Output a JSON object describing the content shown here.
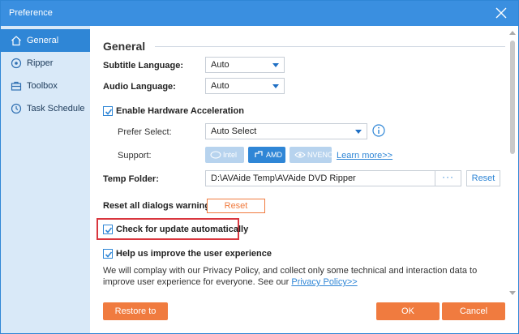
{
  "window": {
    "title": "Preference"
  },
  "sidebar": {
    "items": [
      {
        "label": "General",
        "icon": "home-icon",
        "active": true
      },
      {
        "label": "Ripper",
        "icon": "disc-icon",
        "active": false
      },
      {
        "label": "Toolbox",
        "icon": "toolbox-icon",
        "active": false
      },
      {
        "label": "Task Schedule",
        "icon": "clock-icon",
        "active": false
      }
    ]
  },
  "general": {
    "title": "General",
    "subtitle_language": {
      "label": "Subtitle Language:",
      "value": "Auto"
    },
    "audio_language": {
      "label": "Audio Language:",
      "value": "Auto"
    },
    "hardware_acceleration": {
      "label": "Enable Hardware Acceleration",
      "checked": true,
      "prefer_select": {
        "label": "Prefer Select:",
        "value": "Auto Select"
      },
      "support": {
        "label": "Support:",
        "options": [
          {
            "name": "Intel",
            "enabled": false
          },
          {
            "name": "AMD",
            "enabled": true
          },
          {
            "name": "NVENC",
            "enabled": false
          }
        ],
        "learn_more": "Learn more>>"
      }
    },
    "temp_folder": {
      "label": "Temp Folder:",
      "path": "D:\\AVAide Temp\\AVAide DVD Ripper",
      "more": "···",
      "reset": "Reset"
    },
    "reset_dialogs": {
      "label": "Reset all dialogs warnings:",
      "button": "Reset"
    },
    "check_update": {
      "label": "Check for update automatically",
      "checked": true
    },
    "improve": {
      "label": "Help us improve the user experience",
      "checked": true,
      "description": "We will complay with our Privacy Policy, and collect only some technical and interaction data to improve user experience for everyone. See our",
      "policy_link": "Privacy Policy>>"
    }
  },
  "footer": {
    "restore": "Restore to Default",
    "ok": "OK",
    "cancel": "Cancel"
  },
  "colors": {
    "accent": "#2f86d6",
    "title_bar": "#3a8fe0",
    "orange": "#f07b3f",
    "highlight": "#d9363e",
    "sidebar_bg": "#d9e9f8"
  }
}
